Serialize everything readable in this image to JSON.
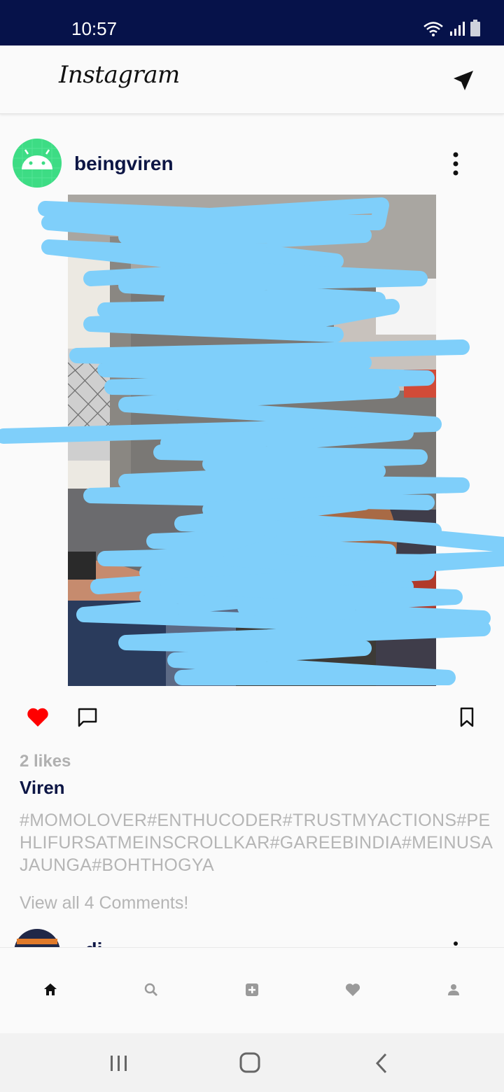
{
  "status_bar": {
    "time": "10:57"
  },
  "app_bar": {
    "title": "Instagram",
    "send_icon": "send-icon"
  },
  "post": {
    "username": "beingviren",
    "avatar_icon": "android-icon",
    "likes_text": "2 likes",
    "liked": true,
    "caption_user": "Viren",
    "caption": "#MOMOLOVER#ENTHUCODER#TRUSTMYACTIONS#PEHLIFURSATMEINSCROLLKAR#GAREEBINDIA#MEINUSAJAUNGA#BOHTHOGYA",
    "view_comments": "View all 4 Comments!"
  },
  "next_post": {
    "username": "..di"
  },
  "bottom_nav": {
    "items": [
      "home-icon",
      "search-icon",
      "add-post-icon",
      "activity-heart-icon",
      "profile-icon"
    ]
  },
  "colors": {
    "status_bar": "#06124a",
    "username": "#0d1645",
    "like": "#ff0000",
    "muted_text": "#b5b5b5",
    "scribble": "#7fcffa"
  }
}
